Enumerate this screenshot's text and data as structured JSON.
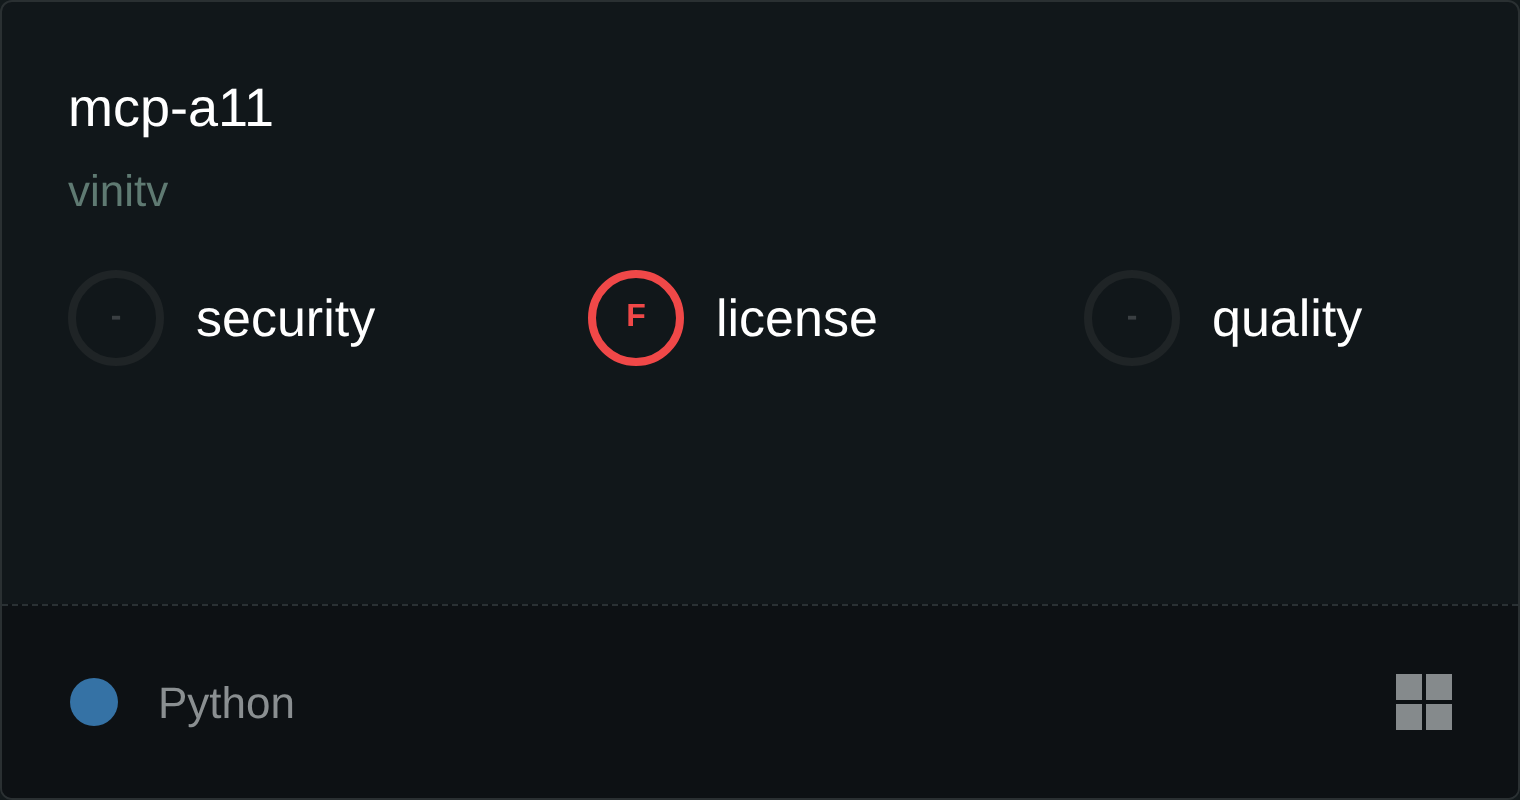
{
  "card": {
    "title": "mcp-a11",
    "author": "vinitv",
    "scores": [
      {
        "grade": "-",
        "label": "security",
        "kind": "none"
      },
      {
        "grade": "F",
        "label": "license",
        "kind": "fail"
      },
      {
        "grade": "-",
        "label": "quality",
        "kind": "none"
      }
    ],
    "footer": {
      "language": "Python",
      "color": "#3572a5"
    }
  }
}
